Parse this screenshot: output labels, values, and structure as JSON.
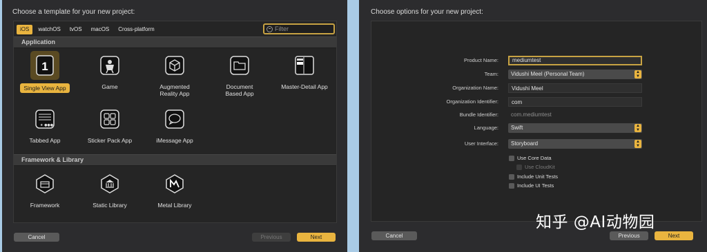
{
  "left": {
    "title": "Choose a template for your new project:",
    "tabs": [
      "iOS",
      "watchOS",
      "tvOS",
      "macOS",
      "Cross-platform"
    ],
    "filter_placeholder": "Filter",
    "sections": {
      "application": "Application",
      "framework": "Framework & Library"
    },
    "templates": [
      {
        "label": "Single View App",
        "icon": "single-view-icon"
      },
      {
        "label": "Game",
        "icon": "game-icon"
      },
      {
        "label": "Augmented Reality App",
        "icon": "ar-icon"
      },
      {
        "label": "Document Based App",
        "icon": "document-icon"
      },
      {
        "label": "Master-Detail App",
        "icon": "master-detail-icon"
      },
      {
        "label": "Tabbed App",
        "icon": "tabbed-icon"
      },
      {
        "label": "Sticker Pack App",
        "icon": "sticker-icon"
      },
      {
        "label": "iMessage App",
        "icon": "imessage-icon"
      }
    ],
    "frameworks": [
      {
        "label": "Framework",
        "icon": "framework-icon"
      },
      {
        "label": "Static Library",
        "icon": "library-icon"
      },
      {
        "label": "Metal Library",
        "icon": "metal-icon"
      }
    ],
    "buttons": {
      "cancel": "Cancel",
      "previous": "Previous",
      "next": "Next"
    }
  },
  "right": {
    "title": "Choose options for your new project:",
    "fields": {
      "product_name": {
        "label": "Product Name:",
        "value": "mediumtest"
      },
      "team": {
        "label": "Team:",
        "value": "Vidushi Meel (Personal Team)"
      },
      "org_name": {
        "label": "Organization Name:",
        "value": "Vidushi Meel"
      },
      "org_id": {
        "label": "Organization Identifier:",
        "value": "com"
      },
      "bundle_id": {
        "label": "Bundle Identifier:",
        "value": "com.mediumtest"
      },
      "language": {
        "label": "Language:",
        "value": "Swift"
      },
      "ui": {
        "label": "User Interface:",
        "value": "Storyboard"
      }
    },
    "checks": {
      "core_data": "Use Core Data",
      "cloudkit": "Use CloudKit",
      "unit_tests": "Include Unit Tests",
      "ui_tests": "Include UI Tests"
    },
    "buttons": {
      "cancel": "Cancel",
      "previous": "Previous",
      "next": "Next"
    }
  },
  "watermark": "知乎 @AI动物园",
  "colors": {
    "accent": "#e9b43f",
    "panel": "#2c2c2e",
    "background": "#a9cbe6"
  }
}
